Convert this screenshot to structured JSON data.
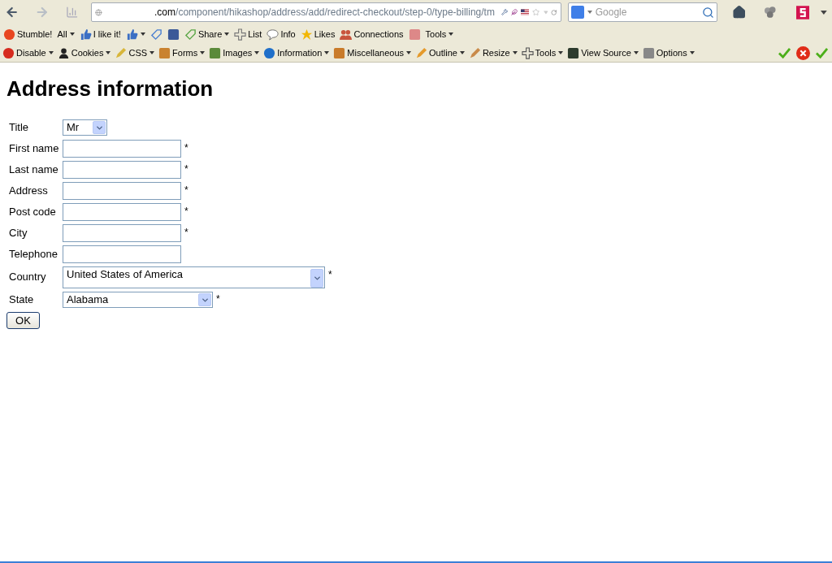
{
  "browser": {
    "url_host": ".com",
    "url_path": "/component/hikashop/address/add/redirect-checkout/step-0/type-billing/tm",
    "search_placeholder": "Google"
  },
  "toolbar_1": [
    {
      "label": "Stumble!",
      "dropdown": false
    },
    {
      "label": "All",
      "dropdown": true
    },
    {
      "label": "I like it!",
      "dropdown": false
    },
    {
      "dropdown": true
    },
    {
      "dropdown": false
    },
    {
      "dropdown": false
    },
    {
      "label": "Share",
      "dropdown": true
    },
    {
      "label": "List",
      "dropdown": false
    },
    {
      "label": "Info",
      "dropdown": false
    },
    {
      "label": "Likes",
      "dropdown": false
    },
    {
      "label": "Connections",
      "dropdown": false
    },
    {
      "dropdown": false
    },
    {
      "label": "Tools",
      "dropdown": true
    }
  ],
  "toolbar_2": [
    {
      "label": "Disable",
      "dropdown": true
    },
    {
      "label": "Cookies",
      "dropdown": true
    },
    {
      "label": "CSS",
      "dropdown": true
    },
    {
      "label": "Forms",
      "dropdown": true
    },
    {
      "label": "Images",
      "dropdown": true
    },
    {
      "label": "Information",
      "dropdown": true
    },
    {
      "label": "Miscellaneous",
      "dropdown": true
    },
    {
      "label": "Outline",
      "dropdown": true
    },
    {
      "label": "Resize",
      "dropdown": true
    },
    {
      "label": "Tools",
      "dropdown": true
    },
    {
      "label": "View Source",
      "dropdown": true
    },
    {
      "label": "Options",
      "dropdown": true
    }
  ],
  "page": {
    "heading": "Address information",
    "fields": [
      {
        "kind": "select",
        "label": "Title",
        "value": "Mr"
      },
      {
        "kind": "text",
        "label": "First name",
        "mark": "*"
      },
      {
        "kind": "text",
        "label": "Last name",
        "mark": "*"
      },
      {
        "kind": "text",
        "label": "Address",
        "mark": "*"
      },
      {
        "kind": "text",
        "label": "Post code",
        "mark": "*"
      },
      {
        "kind": "text",
        "label": "City",
        "mark": "*"
      },
      {
        "kind": "text",
        "label": "Telephone"
      },
      {
        "kind": "select",
        "label": "Country",
        "value": "United States of America",
        "mark": "*"
      },
      {
        "kind": "select",
        "label": "State",
        "value": "Alabama",
        "mark": "*"
      }
    ],
    "submit": "OK"
  }
}
